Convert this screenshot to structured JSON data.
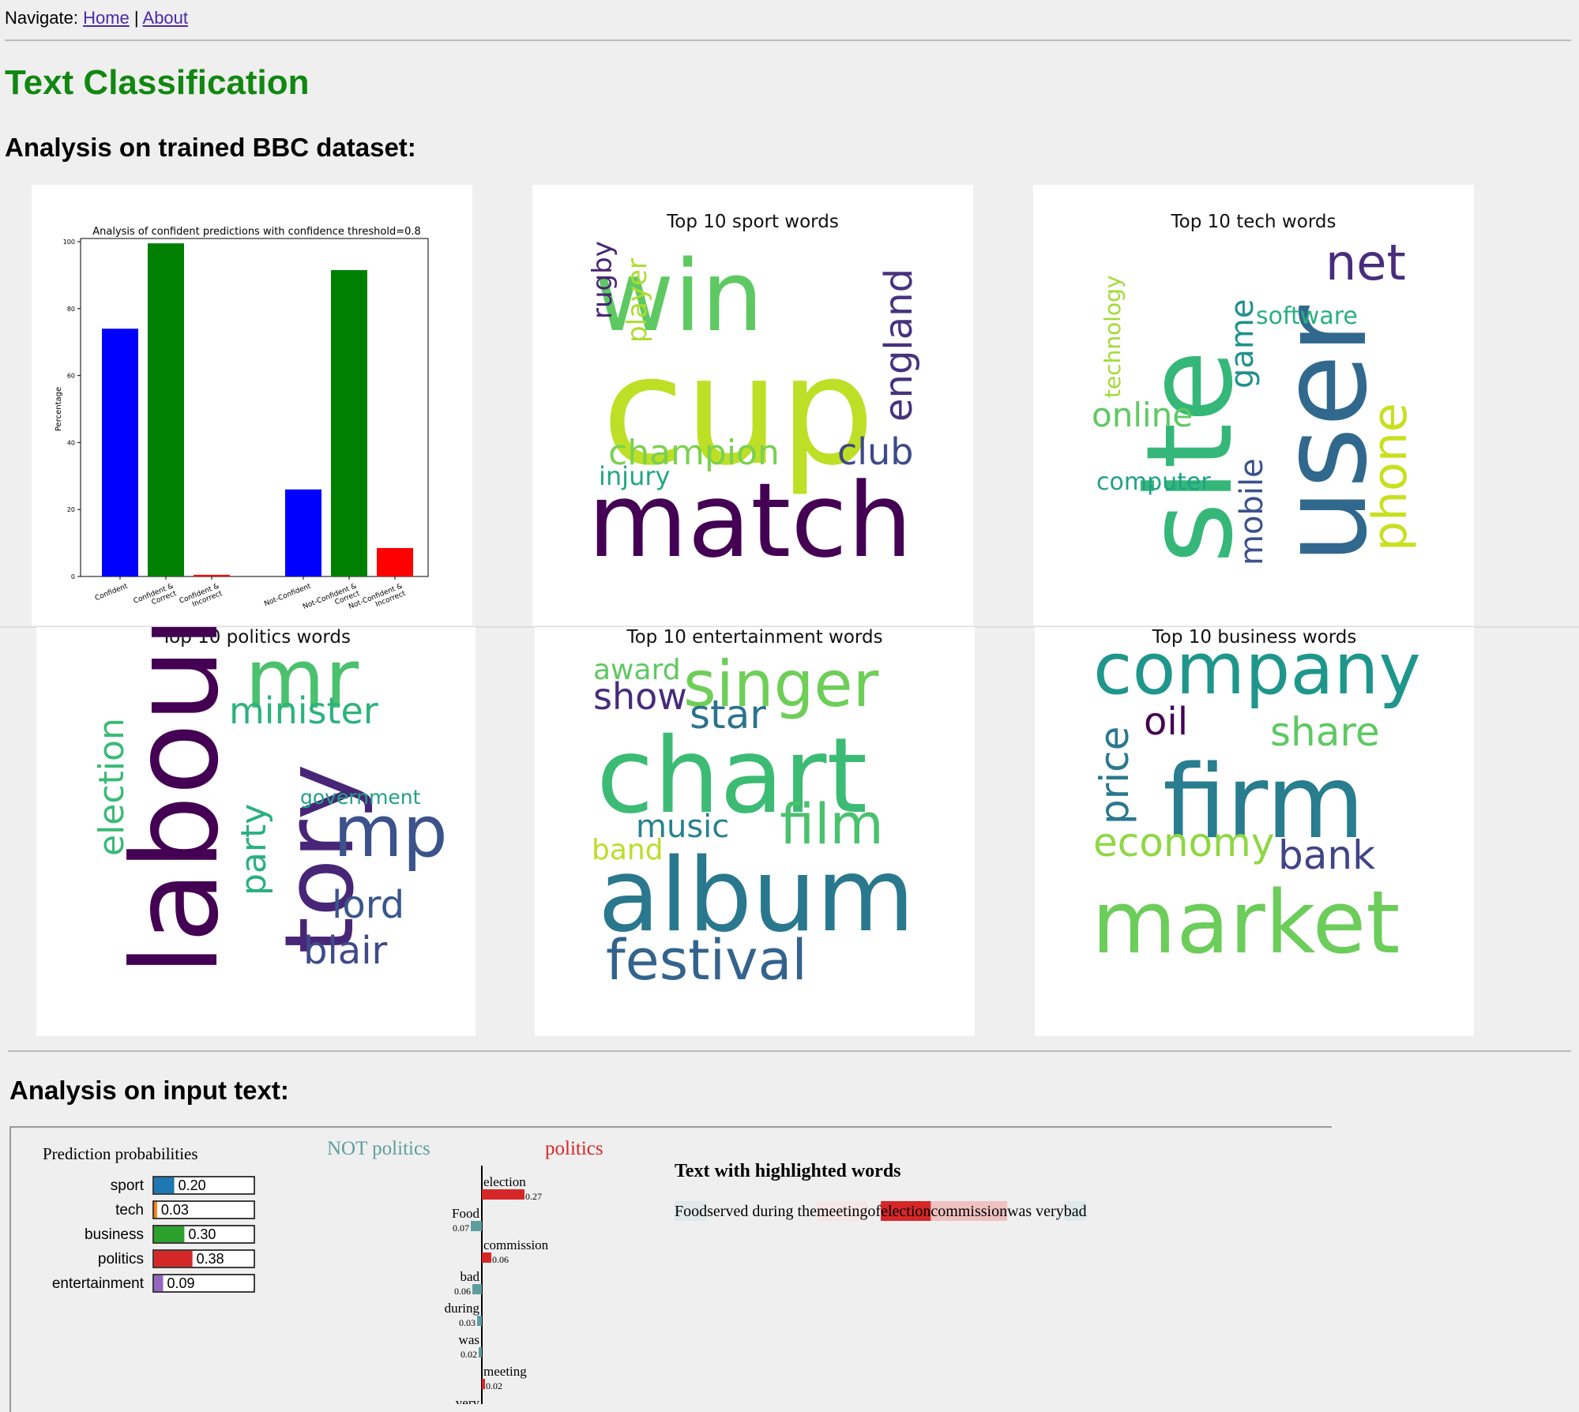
{
  "nav": {
    "prefix": "Navigate:",
    "home": "Home",
    "separator": "|",
    "about": "About"
  },
  "page_title": "Text Classification",
  "section_trained": "Analysis on trained BBC dataset:",
  "section_input": "Analysis on input text:",
  "chart_data": {
    "type": "bar",
    "title": "Analysis of confident predictions with confidence threshold=0.8",
    "xlabel": "",
    "ylabel": "Percentage",
    "ylim": [
      0,
      100
    ],
    "yticks": [
      0,
      20,
      40,
      60,
      80,
      100
    ],
    "categories": [
      "Confident",
      "Confident &\nCorrect",
      "Confident &\nIncorrect",
      "Not-Confident",
      "Not-Confident &\nCorrect",
      "Not-Confident &\nIncorrect"
    ],
    "values": [
      74,
      99.5,
      0.5,
      26,
      91.5,
      8.5
    ],
    "colors": [
      "#0000ff",
      "#008000",
      "#ff0000",
      "#0000ff",
      "#008000",
      "#ff0000"
    ],
    "grid": false
  },
  "wordclouds": [
    {
      "title": "Top 10 sport words",
      "words": [
        {
          "text": "win",
          "color": "#5ec962"
        },
        {
          "text": "cup",
          "color": "#bddf26"
        },
        {
          "text": "match",
          "color": "#440154"
        },
        {
          "text": "rugby",
          "color": "#482475"
        },
        {
          "text": "player",
          "color": "#addc30"
        },
        {
          "text": "england",
          "color": "#46327e"
        },
        {
          "text": "champion",
          "color": "#7ad151"
        },
        {
          "text": "club",
          "color": "#3e4989"
        },
        {
          "text": "injury",
          "color": "#22a884"
        }
      ]
    },
    {
      "title": "Top 10 tech words",
      "words": [
        {
          "text": "site",
          "color": "#35b779"
        },
        {
          "text": "user",
          "color": "#31688e"
        },
        {
          "text": "net",
          "color": "#472d7b"
        },
        {
          "text": "technology",
          "color": "#a2da37"
        },
        {
          "text": "software",
          "color": "#2ab07f"
        },
        {
          "text": "game",
          "color": "#21918c"
        },
        {
          "text": "online",
          "color": "#5ec962"
        },
        {
          "text": "mobile",
          "color": "#3b528b"
        },
        {
          "text": "computer",
          "color": "#1fa187"
        },
        {
          "text": "phone",
          "color": "#c8e020"
        }
      ]
    },
    {
      "title": "Top 10 politics words",
      "words": [
        {
          "text": "labour",
          "color": "#440154"
        },
        {
          "text": "tory",
          "color": "#482677"
        },
        {
          "text": "mr",
          "color": "#4ac16d"
        },
        {
          "text": "minister",
          "color": "#2db27d"
        },
        {
          "text": "election",
          "color": "#3aba76"
        },
        {
          "text": "party",
          "color": "#2ab07f"
        },
        {
          "text": "government",
          "color": "#1fa187"
        },
        {
          "text": "mp",
          "color": "#3b528b"
        },
        {
          "text": "lord",
          "color": "#39568c"
        },
        {
          "text": "blair",
          "color": "#3e4a89"
        }
      ]
    },
    {
      "title": "Top 10 entertainment words",
      "words": [
        {
          "text": "award",
          "color": "#5ec962"
        },
        {
          "text": "singer",
          "color": "#6ece58"
        },
        {
          "text": "show",
          "color": "#472c7a"
        },
        {
          "text": "star",
          "color": "#2c728e"
        },
        {
          "text": "chart",
          "color": "#3cbb75"
        },
        {
          "text": "music",
          "color": "#26828e"
        },
        {
          "text": "film",
          "color": "#4ac16d"
        },
        {
          "text": "band",
          "color": "#bade28"
        },
        {
          "text": "album",
          "color": "#2a788e"
        },
        {
          "text": "festival",
          "color": "#33638d"
        }
      ]
    },
    {
      "title": "Top 10 business words",
      "words": [
        {
          "text": "company",
          "color": "#1f968b"
        },
        {
          "text": "oil",
          "color": "#440154"
        },
        {
          "text": "price",
          "color": "#2a788e"
        },
        {
          "text": "share",
          "color": "#5ec962"
        },
        {
          "text": "firm",
          "color": "#287d8e"
        },
        {
          "text": "economy",
          "color": "#8fd744"
        },
        {
          "text": "bank",
          "color": "#414487"
        },
        {
          "text": "market",
          "color": "#6ccd5a"
        }
      ]
    }
  ],
  "lime": {
    "prob_title": "Prediction probabilities",
    "probs": [
      {
        "label": "sport",
        "value": 0.2,
        "text": "0.20",
        "color": "#1f77b4"
      },
      {
        "label": "tech",
        "value": 0.03,
        "text": "0.03",
        "color": "#ff7f0e"
      },
      {
        "label": "business",
        "value": 0.3,
        "text": "0.30",
        "color": "#2ca02c"
      },
      {
        "label": "politics",
        "value": 0.38,
        "text": "0.38",
        "color": "#d62728"
      },
      {
        "label": "entertainment",
        "value": 0.09,
        "text": "0.09",
        "color": "#9467bd"
      }
    ],
    "not_label": "NOT politics",
    "pos_label": "politics",
    "not_color": "#5f9ea0",
    "pos_color": "#d62728",
    "features": [
      {
        "word": "election",
        "value": 0.27,
        "text": "0.27",
        "side": "pos"
      },
      {
        "word": "Food",
        "value": 0.07,
        "text": "0.07",
        "side": "neg"
      },
      {
        "word": "commission",
        "value": 0.06,
        "text": "0.06",
        "side": "pos"
      },
      {
        "word": "bad",
        "value": 0.06,
        "text": "0.06",
        "side": "neg"
      },
      {
        "word": "during",
        "value": 0.03,
        "text": "0.03",
        "side": "neg"
      },
      {
        "word": "was",
        "value": 0.02,
        "text": "0.02",
        "side": "neg"
      },
      {
        "word": "meeting",
        "value": 0.02,
        "text": "0.02",
        "side": "pos"
      },
      {
        "word": "very",
        "value": 0,
        "text": "",
        "side": "neg"
      }
    ],
    "highlight_title": "Text with highlighted words",
    "tokens": [
      {
        "t": "Food",
        "bg": "#dfe9ea"
      },
      {
        "t": " served during the ",
        "bg": ""
      },
      {
        "t": "meeting",
        "bg": "#f6e6e6"
      },
      {
        "t": " of ",
        "bg": ""
      },
      {
        "t": "election",
        "bg": "#d62728"
      },
      {
        "t": " ",
        "bg": ""
      },
      {
        "t": "commission",
        "bg": "#efc1c1"
      },
      {
        "t": " was very ",
        "bg": ""
      },
      {
        "t": "bad",
        "bg": "#dfe9ea"
      }
    ]
  }
}
